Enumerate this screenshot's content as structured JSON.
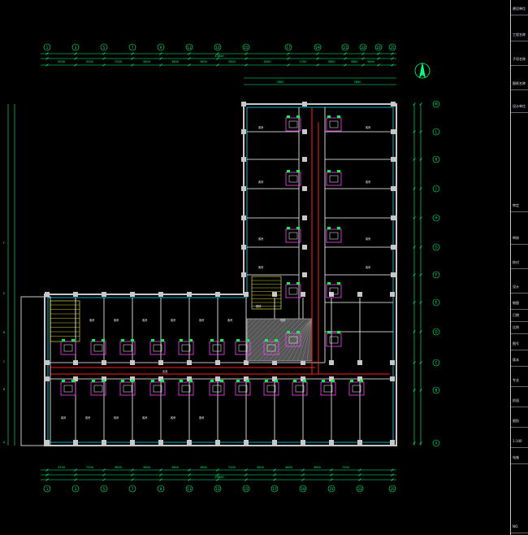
{
  "drawing": {
    "top_grid_labels": [
      "1",
      "3",
      "5",
      "7",
      "9",
      "11",
      "13",
      "15",
      "17",
      "19",
      "21",
      "22",
      "23",
      "25"
    ],
    "bottom_grid_labels": [
      "1",
      "3",
      "5",
      "7",
      "9",
      "11",
      "13",
      "15",
      "17",
      "19",
      "21",
      "23",
      "25"
    ],
    "right_grid_labels": [
      "M",
      "L",
      "K",
      "J",
      "H",
      "G",
      "F",
      "E",
      "D",
      "C",
      "B",
      "A"
    ],
    "left_grid_labels": [
      "F",
      "E",
      "D",
      "C",
      "B",
      "A"
    ],
    "top_dimensions": [
      "3000",
      "3500",
      "7200",
      "3600",
      "3600",
      "3600",
      "3600",
      "4000",
      "3700",
      "3600",
      "3600",
      "3600"
    ],
    "bottom_dimensions": [
      "3700",
      "7200",
      "3600",
      "3600",
      "3600",
      "3600",
      "7200",
      "3600",
      "3600",
      "3600",
      "7200"
    ],
    "upper_dims": [
      "7800",
      "7800"
    ],
    "total_top": "43800",
    "total_bottom": "43800",
    "room_tag": "客房",
    "bath_tag": "卫生间",
    "stair_tag": "楼梯",
    "elevator_tag": "电梯",
    "corridor_tag": "走道"
  },
  "title_block": {
    "cells": [
      "建设单位",
      "工程名称",
      "子项名称",
      "图纸名称",
      "设计单位",
      "审定",
      "审核",
      "校对",
      "设计",
      "制图",
      "日期",
      "比例",
      "图号",
      "版本",
      "专业",
      "阶段",
      "图别",
      "1:100",
      "电施",
      "NO."
    ]
  },
  "colors": {
    "background": "#000000",
    "wall": "#c8c8c8",
    "structure": "#00e5ff",
    "partition": "#ffffff",
    "pipe": "#ff2020",
    "fixture": "#00ff40",
    "furniture": "#ff40ff",
    "dimension": "#00ff7f",
    "hatch": "#a0a0a0",
    "stair": "#ffff40"
  }
}
